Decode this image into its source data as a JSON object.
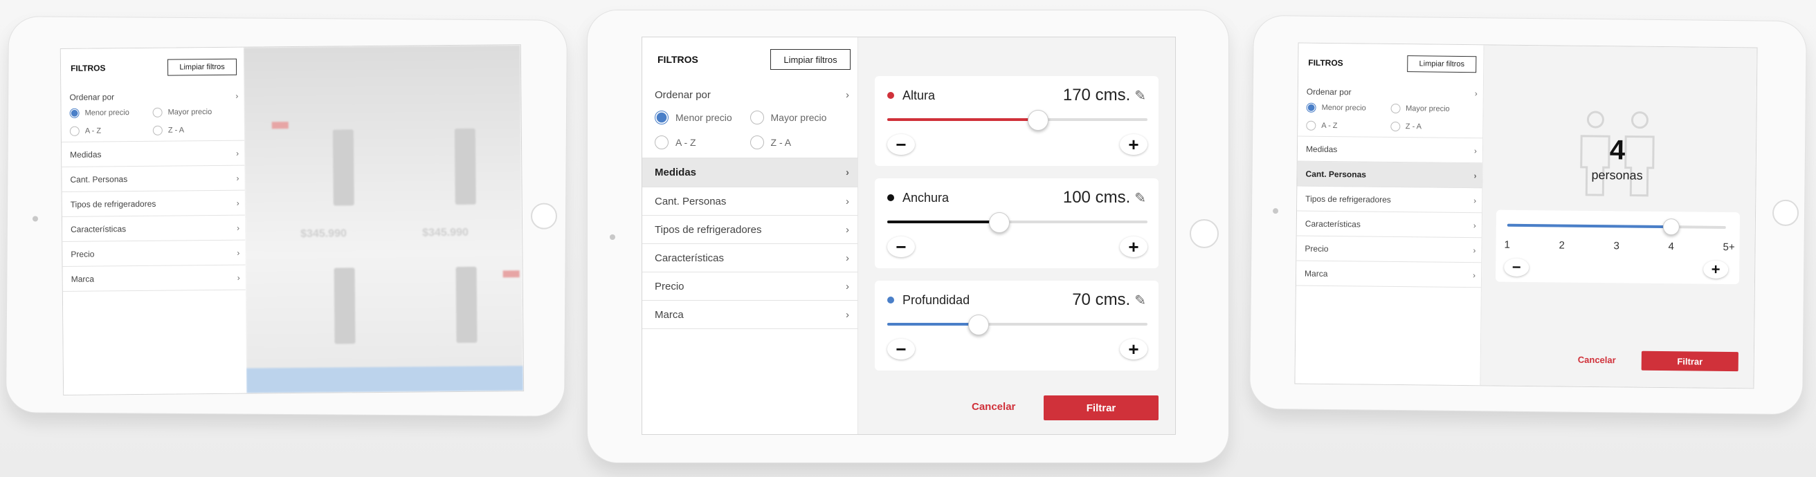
{
  "panel": {
    "title": "FILTROS",
    "clear_label": "Limpiar filtros",
    "sort_label": "Ordenar por",
    "sort_options": [
      "Menor precio",
      "Mayor precio",
      "A - Z",
      "Z - A"
    ],
    "selected_sort": "Menor precio",
    "categories": [
      "Medidas",
      "Cant. Personas",
      "Tipos de refrigeradores",
      "Características",
      "Precio",
      "Marca"
    ]
  },
  "measures": [
    {
      "label": "Altura",
      "value": "170 cms.",
      "color": "#d0313a",
      "fraction": 0.58
    },
    {
      "label": "Anchura",
      "value": "100 cms.",
      "color": "#111111",
      "fraction": 0.43
    },
    {
      "label": "Profundidad",
      "value": "70 cms.",
      "color": "#4a7fc8",
      "fraction": 0.35
    }
  ],
  "persons": {
    "count": "4",
    "unit": "personas",
    "ticks": [
      "1",
      "2",
      "3",
      "4",
      "5+"
    ],
    "selected_fraction": 0.75
  },
  "actions": {
    "cancel_label": "Cancelar",
    "filter_label": "Filtrar"
  },
  "background_products": {
    "prices": [
      "$345.990",
      "$345.990"
    ]
  },
  "colors": {
    "accent": "#d0313a",
    "radio": "#4a7fc8"
  }
}
